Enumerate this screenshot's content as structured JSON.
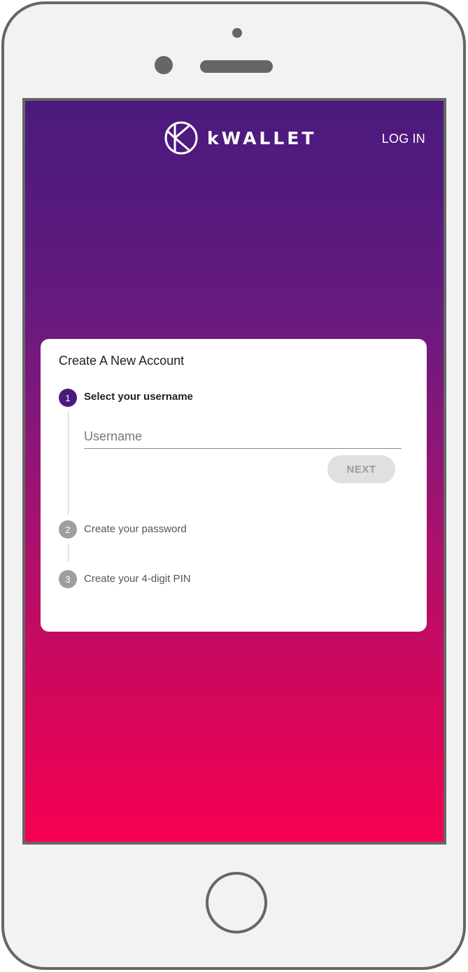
{
  "header": {
    "brand": "kWALLET",
    "login_label": "LOG IN"
  },
  "card": {
    "title": "Create A New Account",
    "steps": [
      {
        "number": "1",
        "label": "Select your username",
        "state": "active"
      },
      {
        "number": "2",
        "label": "Create your password",
        "state": "inactive"
      },
      {
        "number": "3",
        "label": "Create your 4-digit PIN",
        "state": "inactive"
      }
    ],
    "username": {
      "placeholder": "Username",
      "value": ""
    },
    "next_label": "NEXT"
  },
  "icons": {
    "brand_logo": "k-logo-icon"
  },
  "colors": {
    "gradient_top": "#4b1a7d",
    "gradient_bottom": "#f50051",
    "active_step": "#4b1a7d",
    "inactive_step": "#9e9e9e",
    "button_disabled_bg": "#e0e0e0"
  }
}
